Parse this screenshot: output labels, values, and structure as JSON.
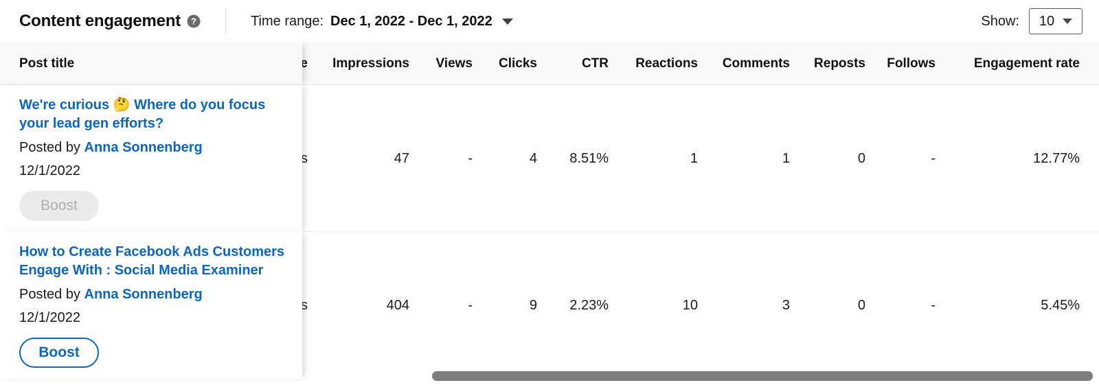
{
  "toolbar": {
    "panel_title": "Content engagement",
    "help_icon": "help-circle-icon",
    "time_range_label": "Time range:",
    "time_range_value": "Dec 1, 2022 - Dec 1, 2022",
    "time_range_caret": "chevron-down-icon",
    "show_label": "Show:",
    "show_value": "10",
    "show_caret": "chevron-down-icon"
  },
  "table": {
    "sticky_header": "Post title",
    "clipped_header": "e",
    "headers": [
      "Impressions",
      "Views",
      "Clicks",
      "CTR",
      "Reactions",
      "Comments",
      "Reposts",
      "Follows",
      "Engagement rate"
    ],
    "rows": [
      {
        "title": "We're curious 🤔 Where do you focus your lead gen efforts?",
        "posted_by_prefix": "Posted by",
        "author": "Anna Sonnenberg",
        "date": "12/1/2022",
        "boost_label": "Boost",
        "boost_state": "disabled",
        "clipped_value": "s",
        "impressions": "47",
        "views": "-",
        "clicks": "4",
        "ctr": "8.51%",
        "reactions": "1",
        "comments": "1",
        "reposts": "0",
        "follows": "-",
        "engagement_rate": "12.77%"
      },
      {
        "title": "How to Create Facebook Ads Customers Engage With : Social Media Examiner",
        "posted_by_prefix": "Posted by",
        "author": "Anna Sonnenberg",
        "date": "12/1/2022",
        "boost_label": "Boost",
        "boost_state": "enabled",
        "clipped_value": "s",
        "impressions": "404",
        "views": "-",
        "clicks": "9",
        "ctr": "2.23%",
        "reactions": "10",
        "comments": "3",
        "reposts": "0",
        "follows": "-",
        "engagement_rate": "5.45%"
      }
    ]
  },
  "scrollbar": {
    "orientation": "horizontal",
    "thumb_color": "#7d7d7d"
  },
  "colors": {
    "link": "#0a66c2",
    "header_bg": "#f8f9fa",
    "text": "#1a1a1a",
    "disabled_bg": "#ebebeb",
    "disabled_text": "#aeaeae"
  }
}
